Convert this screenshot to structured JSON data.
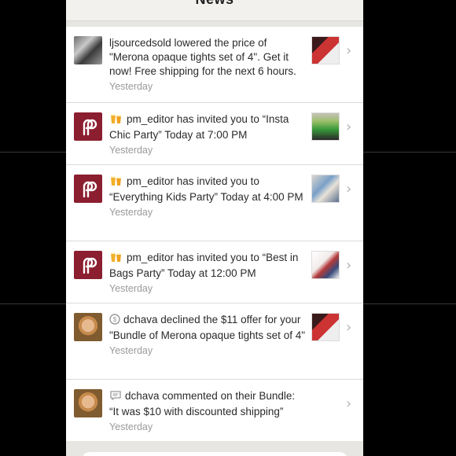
{
  "header": {
    "title": "News"
  },
  "items": [
    {
      "avatar": "user-photo",
      "icon": null,
      "text": "ljsourcedsold lowered the price of \"Merona opaque tights set of 4\". Get it now! Free shipping for the next 6 hours.",
      "time": "Yesterday",
      "thumb": "tights-listing"
    },
    {
      "avatar": "poshmark-logo",
      "icon": "party-cups-icon",
      "text": "pm_editor has invited you to “Insta Chic Party” Today at 7:00 PM",
      "time": "Yesterday",
      "thumb": "green-outfit"
    },
    {
      "avatar": "poshmark-logo",
      "icon": "party-cups-icon",
      "text": "pm_editor has invited you to “Everything Kids Party” Today at 4:00 PM",
      "time": "Yesterday",
      "thumb": "kids-items"
    },
    {
      "avatar": "poshmark-logo",
      "icon": "party-cups-icon",
      "text": "pm_editor has invited you to “Best in Bags Party” Today at 12:00 PM",
      "time": "Yesterday",
      "thumb": "bags-outfit"
    },
    {
      "avatar": "user-photo",
      "icon": "dollar-circle-icon",
      "text": "dchava declined the $11 offer for your \"Bundle of Merona opaque tights set of 4\"",
      "time": "Yesterday",
      "thumb": "tights-listing"
    },
    {
      "avatar": "user-photo",
      "icon": "comment-bubble-icon",
      "text": "dchava commented on their Bundle: “It was $10 with discounted shipping”",
      "time": "Yesterday",
      "thumb": null
    }
  ],
  "colors": {
    "background": "#000000",
    "page": "#e8e6e3",
    "row": "#ffffff",
    "text": "#2a2a2a",
    "muted": "#9a9a9a",
    "brand": "#8b1e2f"
  }
}
